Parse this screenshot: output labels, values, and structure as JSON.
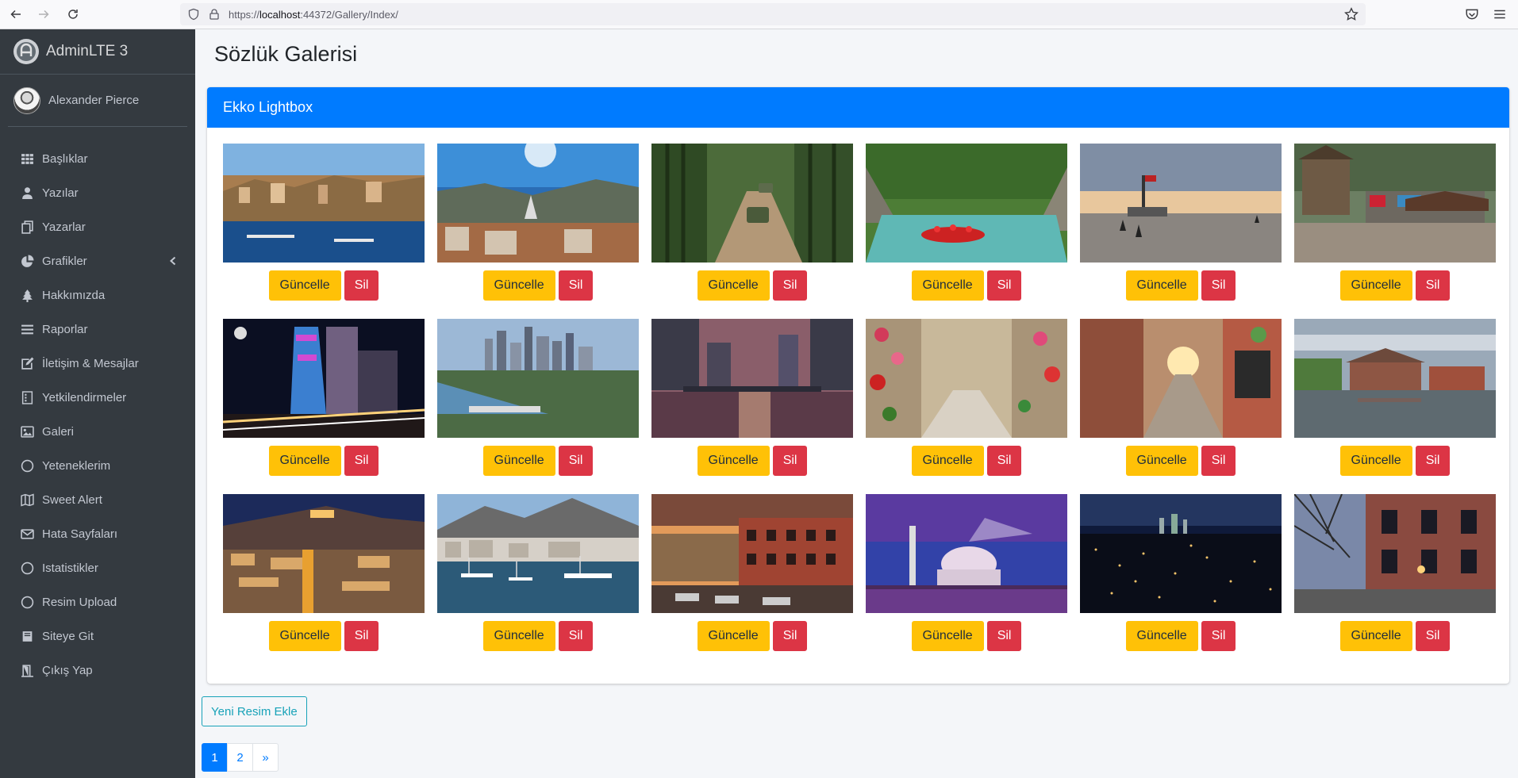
{
  "browser": {
    "url_prefix": "https://",
    "url_host": "localhost",
    "url_rest": ":44372/Gallery/Index/"
  },
  "sidebar": {
    "brand": "AdminLTE 3",
    "user": "Alexander Pierce",
    "items": [
      {
        "label": "Başlıklar",
        "icon": "th-icon"
      },
      {
        "label": "Yazılar",
        "icon": "user-tie-icon"
      },
      {
        "label": "Yazarlar",
        "icon": "copy-icon"
      },
      {
        "label": "Grafikler",
        "icon": "chart-pie-icon"
      },
      {
        "label": "Hakkımızda",
        "icon": "tree-icon"
      },
      {
        "label": "Raporlar",
        "icon": "bars-icon"
      },
      {
        "label": "İletişim & Mesajlar",
        "icon": "edit-icon"
      },
      {
        "label": "Yetkilendirmeler",
        "icon": "list-box-icon"
      },
      {
        "label": "Galeri",
        "icon": "image-icon"
      },
      {
        "label": "Yeteneklerim",
        "icon": "circle-icon"
      },
      {
        "label": "Sweet Alert",
        "icon": "map-icon"
      },
      {
        "label": "Hata Sayfaları",
        "icon": "envelope-icon"
      },
      {
        "label": "Istatistikler",
        "icon": "circle-icon"
      },
      {
        "label": "Resim Upload",
        "icon": "circle-icon"
      },
      {
        "label": "Siteye Git",
        "icon": "book-icon"
      },
      {
        "label": "Çıkış Yap",
        "icon": "door-icon"
      }
    ]
  },
  "page": {
    "title": "Sözlük Galerisi",
    "card_title": "Ekko Lightbox",
    "update_label": "Güncelle",
    "delete_label": "Sil",
    "new_image_label": "Yeni Resim Ekle",
    "pagination": [
      "1",
      "2",
      "»"
    ],
    "active_page": "1"
  },
  "gallery": [
    {
      "scene": "harbor-old-town"
    },
    {
      "scene": "coastal-marina"
    },
    {
      "scene": "forest-jeep"
    },
    {
      "scene": "river-rafting"
    },
    {
      "scene": "plaza-sunset"
    },
    {
      "scene": "tree-house-market"
    },
    {
      "scene": "night-dancing-house"
    },
    {
      "scene": "city-skyline-coast"
    },
    {
      "scene": "river-city-dusk"
    },
    {
      "scene": "flower-alley"
    },
    {
      "scene": "sunlit-street"
    },
    {
      "scene": "river-town"
    },
    {
      "scene": "hill-city-night"
    },
    {
      "scene": "monaco-harbor"
    },
    {
      "scene": "brick-street-sunset"
    },
    {
      "scene": "mosque-twilight"
    },
    {
      "scene": "city-lights-night"
    },
    {
      "scene": "brick-building-trees"
    }
  ]
}
